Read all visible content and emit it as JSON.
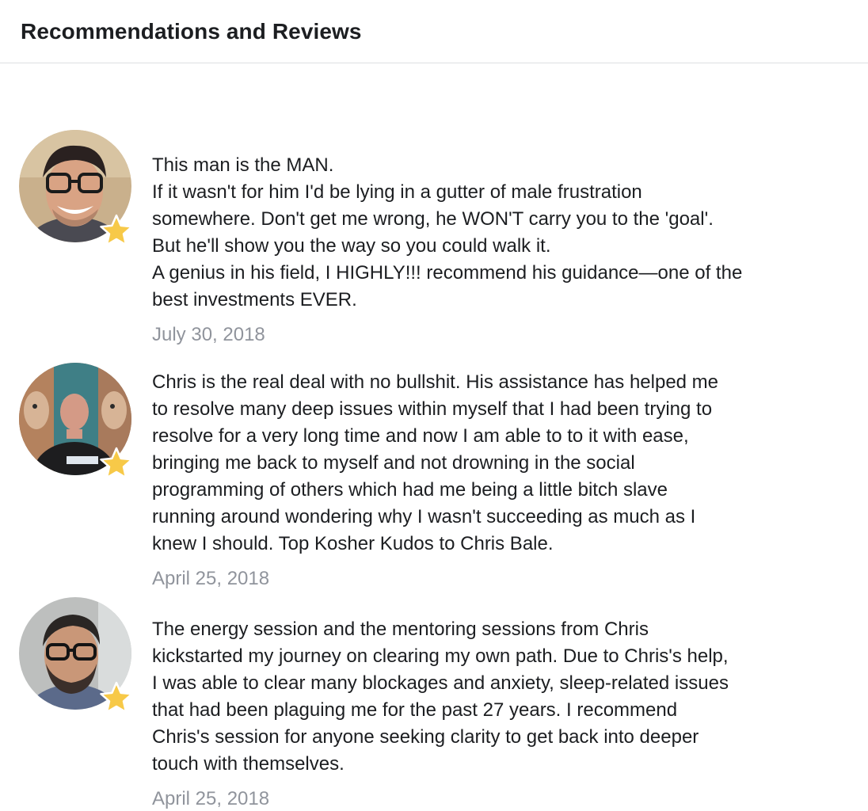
{
  "header": {
    "title": "Recommendations and Reviews"
  },
  "accent_colors": {
    "star": "#f7c948",
    "date_text": "#90949c",
    "divider": "#dddfe2"
  },
  "reviews": [
    {
      "icon": "recommendation-star-icon",
      "text": "This man is the MAN.\nIf it wasn't for him I'd be lying in a gutter of male frustration\nsomewhere. Don't get me wrong, he WON'T carry you to the 'goal'.\nBut he'll show you the way so you could walk it.\nA genius in his field, I HIGHLY!!! recommend his guidance—one of the\nbest investments EVER.",
      "date": "July 30, 2018"
    },
    {
      "icon": "recommendation-star-icon",
      "text": "Chris is the real deal with no bullshit. His assistance has helped me\nto resolve many deep issues within myself that I had been trying to\nresolve for a very long time and now I am able to to it with ease,\nbringing me back to myself and not drowning in the social\nprogramming of others which had me being a little bitch slave\nrunning around wondering why I wasn't succeeding as much as I\nknew I should. Top Kosher Kudos to Chris Bale.",
      "date": "April 25, 2018"
    },
    {
      "icon": "recommendation-star-icon",
      "text": "The energy session and the mentoring sessions from Chris\nkickstarted my journey on clearing my own path. Due to Chris's help,\nI was able to clear many blockages and anxiety, sleep-related issues\nthat had been plaguing me for the past 27 years. I recommend\nChris's session for anyone seeking clarity to get back into deeper\ntouch with themselves.",
      "date": "April 25, 2018"
    }
  ]
}
